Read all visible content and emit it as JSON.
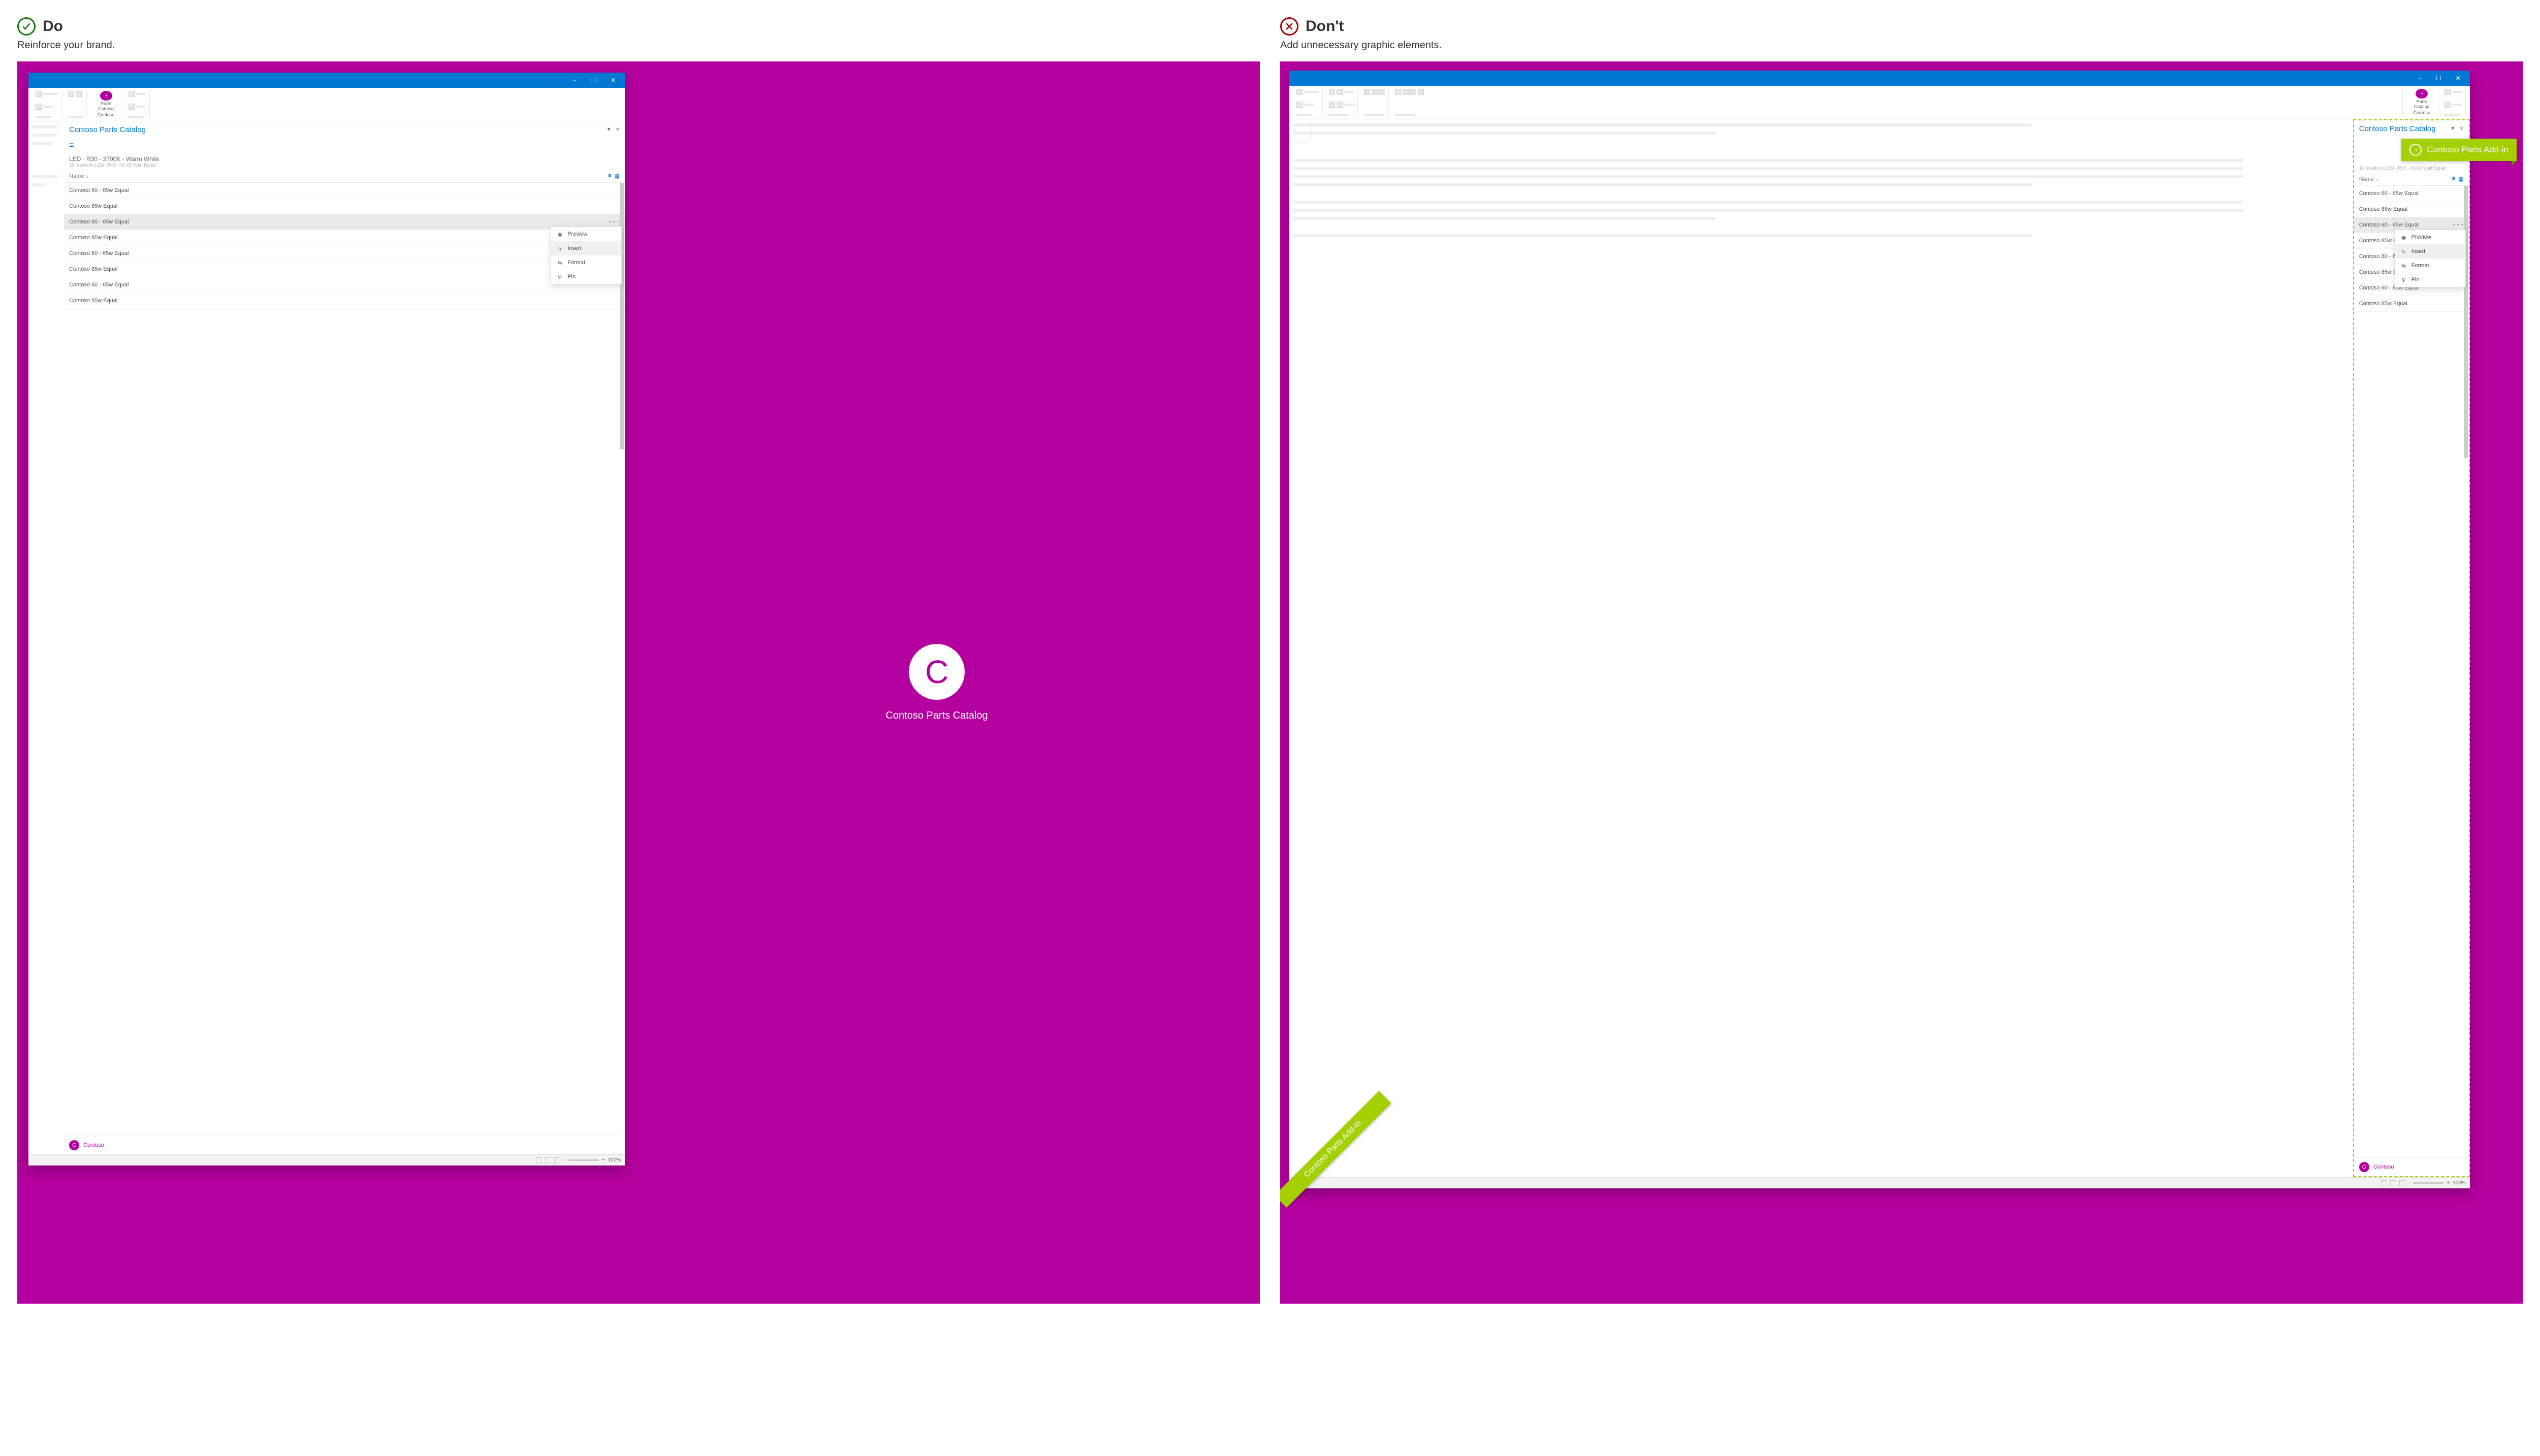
{
  "do": {
    "heading": "Do",
    "subtitle": "Reinforce your brand.",
    "hero_letter": "C",
    "hero_title": "Contoso Parts Catalog"
  },
  "dont": {
    "heading": "Don't",
    "subtitle": "Add unnecessary graphic elements.",
    "banner_text": "Contoso Parts Add-in",
    "diagonal_text": "Contoso Parts Add-in"
  },
  "ribbon": {
    "addin_label": "Parts Catalog",
    "addin_sublabel": "Contoso"
  },
  "pane": {
    "title": "Contoso Parts Catalog",
    "query": "LED - R30 - 2700K - Warm White",
    "results_meta": "16 results in LED - R30 - 60-65 Watt Equal",
    "sort_label": "Name",
    "items": [
      "Contoso 60 - 65w Equal",
      "Contoso 85w Equal",
      "Contoso 60 - 65w Equal",
      "Contoso 85w Equal",
      "Contoso 60 - 65w Equal",
      "Contoso 85w Equal",
      "Contoso 60 - 65w Equal",
      "Contoso 85w Equal"
    ],
    "footer_brand": "Contoso",
    "footer_letter": "C"
  },
  "ctx": {
    "preview": "Preview",
    "insert": "Insert",
    "format": "Format",
    "pin": "Pin"
  },
  "status": {
    "zoom": "100%",
    "plus": "+",
    "minus": "-"
  },
  "win": {
    "min": "−",
    "max": "☐",
    "close": "✕"
  }
}
